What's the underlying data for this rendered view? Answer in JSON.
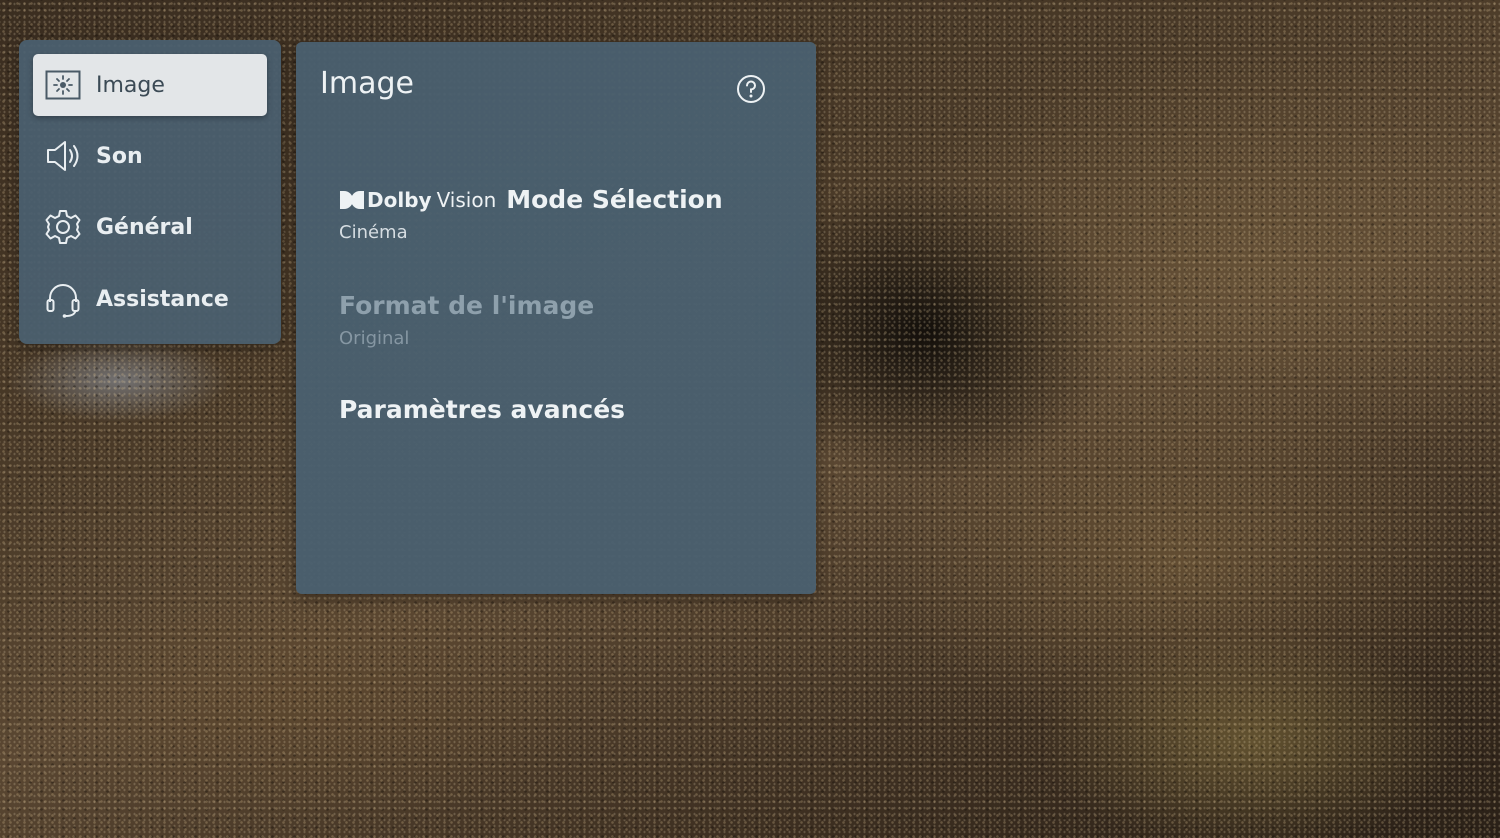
{
  "menu": {
    "items": [
      {
        "label": "Image",
        "icon": "picture-settings-icon",
        "selected": true
      },
      {
        "label": "Son",
        "icon": "speaker-icon",
        "selected": false
      },
      {
        "label": "Général",
        "icon": "gear-icon",
        "selected": false
      },
      {
        "label": "Assistance",
        "icon": "headset-icon",
        "selected": false
      }
    ]
  },
  "panel": {
    "title": "Image",
    "help_icon": "help-circle-icon",
    "options": [
      {
        "brand": "Dolby",
        "brand_suffix": "Vision",
        "title": "Mode Sélection",
        "value": "Cinéma",
        "enabled": true
      },
      {
        "title": "Format de l'image",
        "value": "Original",
        "enabled": false
      },
      {
        "title": "Paramètres avancés",
        "enabled": true
      }
    ]
  },
  "colors": {
    "panel_bg": "#4a6070",
    "selected_bg": "#e3e6e8",
    "text_primary": "#eef2f4",
    "text_disabled": "#8ea0ac"
  }
}
